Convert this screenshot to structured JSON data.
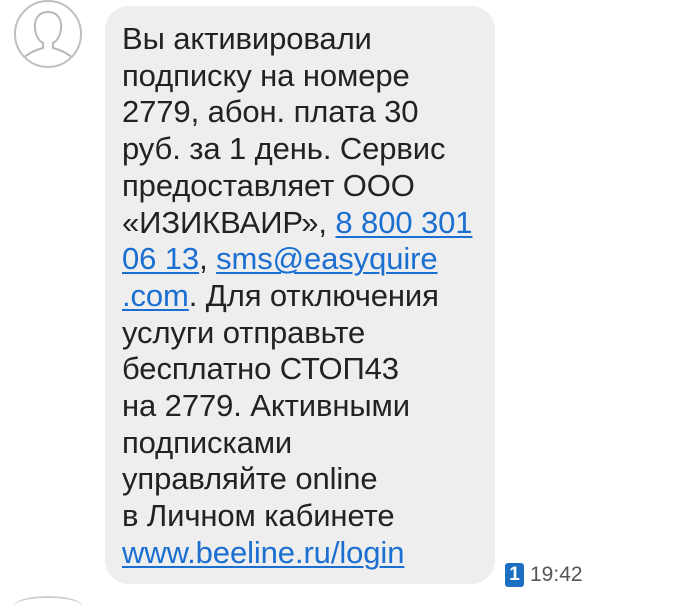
{
  "message": {
    "lines": [
      "Вы активировали",
      "подписку на номере",
      "2779, абон. плата 30",
      "руб. за 1 день. Сервис",
      "предоставляет ООО",
      "«ИЗИКВАИР», ",
      "8 800 301",
      "06 13",
      ", ",
      "sms@easyquire",
      ".com",
      ". Для отключения",
      "услуги отправьте",
      "бесплатно СТОП43",
      "на 2779. Активными",
      "подписками",
      "управляйте online",
      "в Личном кабинете",
      "www.beeline.ru/login"
    ]
  },
  "meta": {
    "sim_number": "1",
    "time": "19:42"
  },
  "colors": {
    "bubble_bg": "#eeeeee",
    "link": "#1a6fd1",
    "sim_badge": "#1d6fc1"
  }
}
